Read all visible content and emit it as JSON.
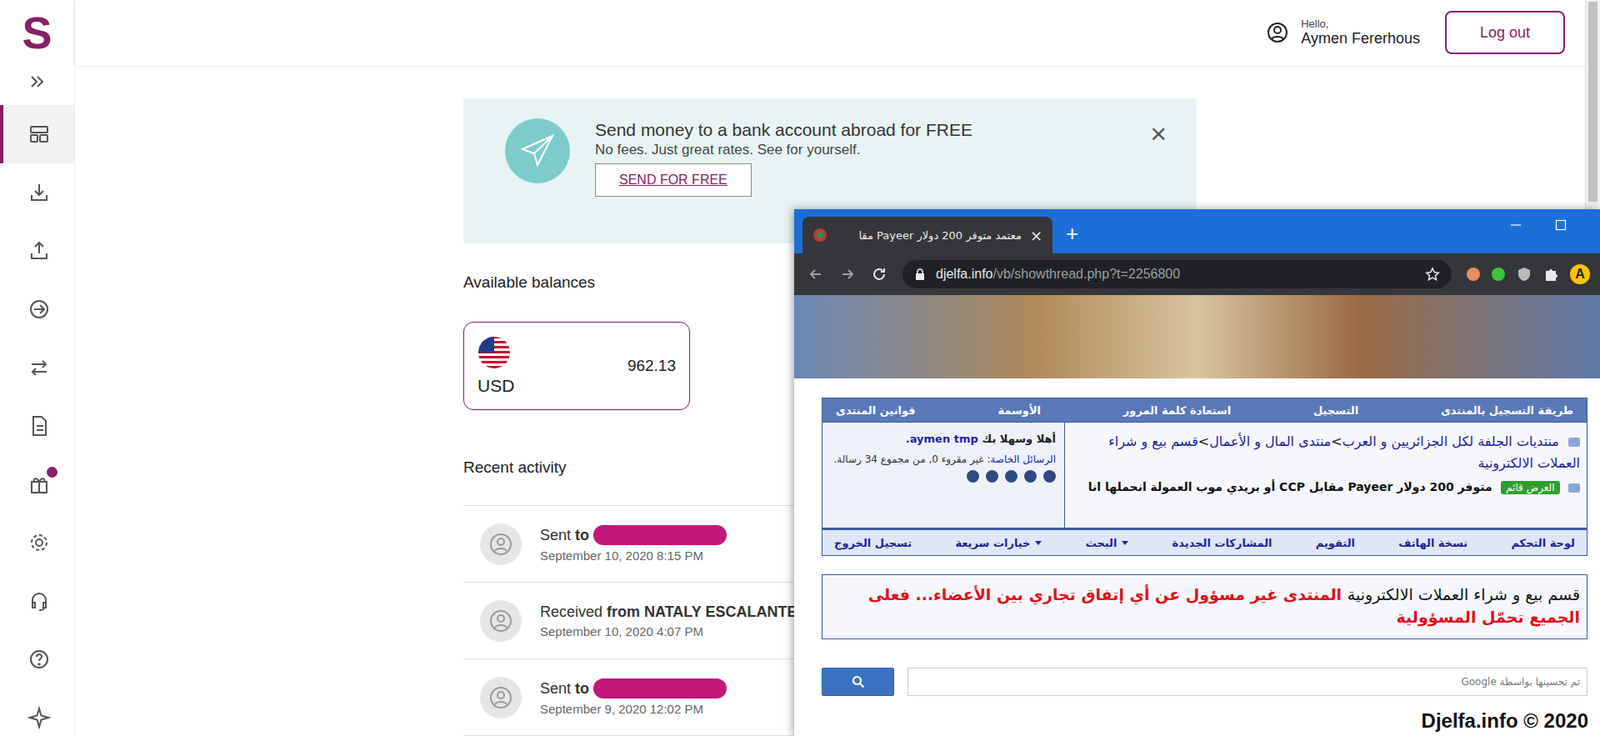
{
  "app": {
    "logo": "S"
  },
  "sidebar": {
    "items": [
      {
        "selected": true,
        "badge": false
      },
      {
        "selected": false,
        "badge": false
      },
      {
        "selected": false,
        "badge": false
      },
      {
        "selected": false,
        "badge": false
      },
      {
        "selected": false,
        "badge": false
      },
      {
        "selected": false,
        "badge": false
      },
      {
        "selected": false,
        "badge": true
      },
      {
        "selected": false,
        "badge": false
      },
      {
        "selected": false,
        "badge": false
      },
      {
        "selected": false,
        "badge": false
      },
      {
        "selected": false,
        "badge": false
      }
    ]
  },
  "header": {
    "greeting": "Hello,",
    "user": "Aymen Fererhous",
    "logout": "Log out"
  },
  "banner": {
    "title": "Send money to a bank account abroad for FREE",
    "subtitle": "No fees. Just great rates. See for yourself.",
    "button": "SEND FOR FREE",
    "close": "×"
  },
  "balances": {
    "heading": "Available balances",
    "items": [
      {
        "currency": "USD",
        "amount": "962.13"
      }
    ]
  },
  "activity": {
    "heading": "Recent activity",
    "items": [
      {
        "action": "Sent",
        "party": "to",
        "redacted": true,
        "date": "September 10, 2020 8:15 PM"
      },
      {
        "action": "Received",
        "party": "from NATALY ESCALANTE",
        "redacted": false,
        "date": "September 10, 2020 4:07 PM"
      },
      {
        "action": "Sent",
        "party": "to",
        "redacted": true,
        "date": "September 9, 2020 12:02 PM"
      }
    ]
  },
  "browser": {
    "tab": {
      "title": "معتمد متوفر 200 دولار Payeer مقا",
      "close": "×",
      "selected": true
    },
    "new_tab": "+",
    "url_host": "djelfa.info",
    "url_path": "/vb/showthread.php?t=2256800",
    "profile": "A",
    "forum": {
      "nav_top": [
        "طريقة التسجيل بالمنتدى",
        "التسجيل",
        "استعادة كلمة المرور",
        "الأوسمة",
        "قوانين المنتدى"
      ],
      "breadcrumb": {
        "items": [
          "منتديات الجلفة لكل الجزائريين و العرب",
          "منتدى المال و الأعمال",
          "قسم بيع و شراء العملات الالكترونية"
        ],
        "separator": ">"
      },
      "thread": {
        "badge": "العرض قائم",
        "title": "متوفر 200 دولار Payeer مقابل CCP أو بريدي موب العمولة انحملها انا"
      },
      "welcome": {
        "greeting": "أهلا وسهلا بك",
        "user": "aymen tmp."
      },
      "pm": {
        "label": "الرسائل الخاصة:",
        "text": "غير مقروء 0, من مجموع 34 رسالة."
      },
      "nav_bottom": [
        {
          "label": "لوحة التحكم",
          "dropdown": false
        },
        {
          "label": "نسخة الهاتف",
          "dropdown": false
        },
        {
          "label": "التقويم",
          "dropdown": false
        },
        {
          "label": "المشاركات الجديدة",
          "dropdown": false
        },
        {
          "label": "البحث",
          "dropdown": true
        },
        {
          "label": "خيارات سريعة",
          "dropdown": true
        },
        {
          "label": "تسجيل الخروج",
          "dropdown": false
        }
      ],
      "notice": {
        "section": "قسم بيع و شراء العملات الالكترونية",
        "warning": "المنتدى غير مسؤول عن أي إتفاق تجاري بين الأعضاء... فعلى الجميع تحمّل المسؤولية"
      },
      "search": {
        "placeholder": "تم تحسينها بواسطة Google"
      }
    },
    "watermark": "Djelfa.info © 2020"
  }
}
